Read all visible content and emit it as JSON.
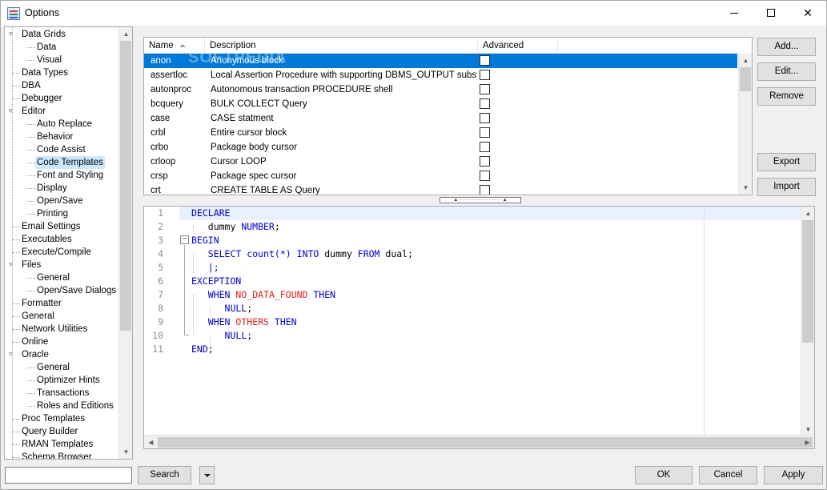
{
  "window": {
    "title": "Options"
  },
  "tree": {
    "items": [
      {
        "label": "Data Grids",
        "level": 0,
        "expander": "collapse"
      },
      {
        "label": "Data",
        "level": 1
      },
      {
        "label": "Visual",
        "level": 1
      },
      {
        "label": "Data Types",
        "level": 0
      },
      {
        "label": "DBA",
        "level": 0
      },
      {
        "label": "Debugger",
        "level": 0
      },
      {
        "label": "Editor",
        "level": 0,
        "expander": "collapse"
      },
      {
        "label": "Auto Replace",
        "level": 1
      },
      {
        "label": "Behavior",
        "level": 1
      },
      {
        "label": "Code Assist",
        "level": 1
      },
      {
        "label": "Code Templates",
        "level": 1,
        "selected": true
      },
      {
        "label": "Font and Styling",
        "level": 1
      },
      {
        "label": "Display",
        "level": 1
      },
      {
        "label": "Open/Save",
        "level": 1
      },
      {
        "label": "Printing",
        "level": 1
      },
      {
        "label": "Email Settings",
        "level": 0
      },
      {
        "label": "Executables",
        "level": 0
      },
      {
        "label": "Execute/Compile",
        "level": 0
      },
      {
        "label": "Files",
        "level": 0,
        "expander": "collapse"
      },
      {
        "label": "General",
        "level": 1
      },
      {
        "label": "Open/Save Dialogs",
        "level": 1
      },
      {
        "label": "Formatter",
        "level": 0
      },
      {
        "label": "General",
        "level": 0
      },
      {
        "label": "Network Utilities",
        "level": 0
      },
      {
        "label": "Online",
        "level": 0
      },
      {
        "label": "Oracle",
        "level": 0,
        "expander": "collapse"
      },
      {
        "label": "General",
        "level": 1
      },
      {
        "label": "Optimizer Hints",
        "level": 1
      },
      {
        "label": "Transactions",
        "level": 1
      },
      {
        "label": "Roles and Editions",
        "level": 1
      },
      {
        "label": "Proc Templates",
        "level": 0
      },
      {
        "label": "Query Builder",
        "level": 0
      },
      {
        "label": "RMAN Templates",
        "level": 0
      },
      {
        "label": "Schema Browser",
        "level": 0
      }
    ]
  },
  "grid": {
    "columns": {
      "name": "Name",
      "description": "Description",
      "advanced": "Advanced"
    },
    "rows": [
      {
        "name": "anon",
        "description": "Anonymous block",
        "advanced": false,
        "selected": true
      },
      {
        "name": "assertloc",
        "description": "Local Assertion Procedure with supporting DBMS_OUTPUT substitute",
        "advanced": false
      },
      {
        "name": "autonproc",
        "description": "Autonomous transaction PROCEDURE shell",
        "advanced": false
      },
      {
        "name": "bcquery",
        "description": "BULK COLLECT Query",
        "advanced": false
      },
      {
        "name": "case",
        "description": "CASE statment",
        "advanced": false
      },
      {
        "name": "crbl",
        "description": "Entire cursor block",
        "advanced": false
      },
      {
        "name": "crbo",
        "description": "Package body cursor",
        "advanced": false
      },
      {
        "name": "crloop",
        "description": "Cursor LOOP",
        "advanced": false
      },
      {
        "name": "crsp",
        "description": "Package spec cursor",
        "advanced": false
      },
      {
        "name": "crt",
        "description": "CREATE TABLE AS Query",
        "advanced": false
      }
    ],
    "watermark": "SOFTPEDIA"
  },
  "buttons": {
    "add": "Add...",
    "edit": "Edit...",
    "remove": "Remove",
    "export": "Export",
    "import": "Import",
    "search": "Search",
    "ok": "OK",
    "cancel": "Cancel",
    "apply": "Apply"
  },
  "splitter": {
    "grip": "▲ ·························· ▲"
  },
  "editor": {
    "lines": [
      {
        "n": "1",
        "tokens": [
          {
            "t": "DECLARE",
            "c": "kw"
          }
        ]
      },
      {
        "n": "2",
        "tokens": [
          {
            "t": "   dummy ",
            "c": ""
          },
          {
            "t": "NUMBER",
            "c": "kw"
          },
          {
            "t": ";",
            "c": ""
          }
        ]
      },
      {
        "n": "3",
        "tokens": [
          {
            "t": "BEGIN",
            "c": "kw"
          }
        ]
      },
      {
        "n": "4",
        "tokens": [
          {
            "t": "   ",
            "c": ""
          },
          {
            "t": "SELECT",
            "c": "kw"
          },
          {
            "t": " ",
            "c": ""
          },
          {
            "t": "count",
            "c": "kw"
          },
          {
            "t": "(*)",
            "c": "pn"
          },
          {
            "t": " ",
            "c": ""
          },
          {
            "t": "INTO",
            "c": "kw"
          },
          {
            "t": " dummy ",
            "c": ""
          },
          {
            "t": "FROM",
            "c": "kw"
          },
          {
            "t": " dual;",
            "c": ""
          }
        ]
      },
      {
        "n": "5",
        "tokens": [
          {
            "t": "   |;",
            "c": "pn"
          }
        ]
      },
      {
        "n": "6",
        "tokens": [
          {
            "t": "EXCEPTION",
            "c": "kw"
          }
        ]
      },
      {
        "n": "7",
        "tokens": [
          {
            "t": "   ",
            "c": ""
          },
          {
            "t": "WHEN",
            "c": "kw"
          },
          {
            "t": " ",
            "c": ""
          },
          {
            "t": "NO_DATA_FOUND",
            "c": "ex"
          },
          {
            "t": " ",
            "c": ""
          },
          {
            "t": "THEN",
            "c": "kw"
          }
        ]
      },
      {
        "n": "8",
        "tokens": [
          {
            "t": "      ",
            "c": ""
          },
          {
            "t": "NULL",
            "c": "kw"
          },
          {
            "t": ";",
            "c": ""
          }
        ]
      },
      {
        "n": "9",
        "tokens": [
          {
            "t": "   ",
            "c": ""
          },
          {
            "t": "WHEN",
            "c": "kw"
          },
          {
            "t": " ",
            "c": ""
          },
          {
            "t": "OTHERS",
            "c": "ex"
          },
          {
            "t": " ",
            "c": ""
          },
          {
            "t": "THEN",
            "c": "kw"
          }
        ]
      },
      {
        "n": "10",
        "tokens": [
          {
            "t": "      ",
            "c": ""
          },
          {
            "t": "NULL",
            "c": "kw"
          },
          {
            "t": ";",
            "c": ""
          }
        ]
      },
      {
        "n": "11",
        "tokens": [
          {
            "t": "END",
            "c": "kw"
          },
          {
            "t": ";",
            "c": ""
          }
        ]
      }
    ]
  },
  "search": {
    "value": ""
  },
  "colors": {
    "selection": "#0078d7",
    "tree_selection": "#cce8ff",
    "keyword": "#0000c8",
    "exception": "#e01e1e",
    "current_line": "#e8f2fe"
  }
}
